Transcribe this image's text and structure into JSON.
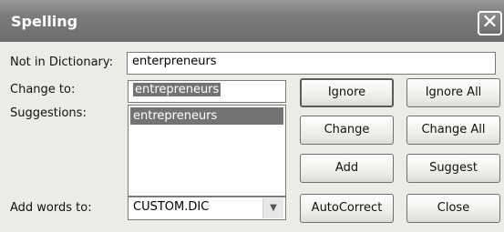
{
  "window": {
    "title": "Spelling",
    "close_glyph": "✕"
  },
  "labels": {
    "not_in_dictionary": "Not in Dictionary:",
    "change_to": "Change to:",
    "suggestions": "Suggestions:",
    "add_words_to": "Add words to:"
  },
  "fields": {
    "not_in_dictionary_value": "enterpreneurs",
    "change_to_value": "entrepreneurs",
    "add_words_to_value": "CUSTOM.DIC"
  },
  "suggestions": [
    "entrepreneurs"
  ],
  "buttons": {
    "ignore": "Ignore",
    "ignore_all": "Ignore All",
    "change": "Change",
    "change_all": "Change All",
    "add": "Add",
    "suggest": "Suggest",
    "autocorrect": "AutoCorrect",
    "close": "Close"
  },
  "icons": {
    "dropdown": "chevron-down-icon",
    "close": "close-icon"
  }
}
